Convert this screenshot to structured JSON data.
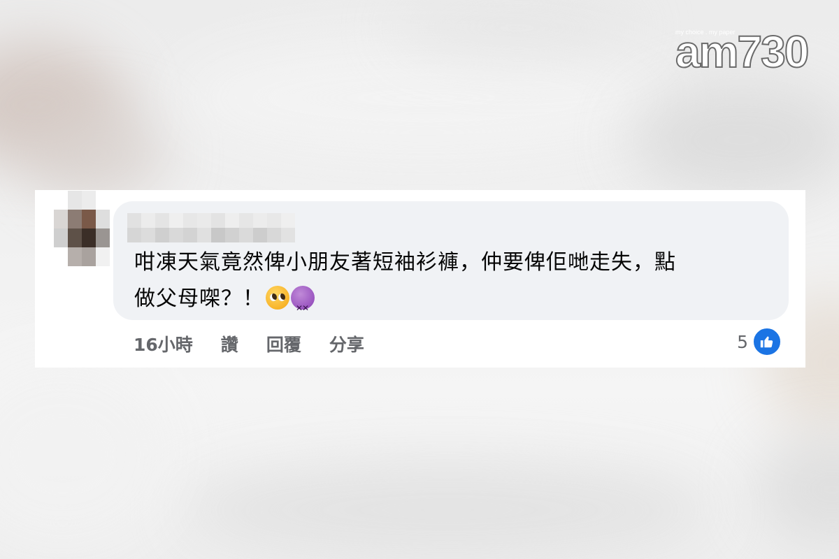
{
  "logo": {
    "tagline": "my choice . my paper",
    "text": "am730"
  },
  "comment": {
    "author_name": "",
    "text_line1": "咁凍天氣竟然俾小朋友著短袖衫褲，仲要俾佢哋走失，點",
    "text_line2": "做父母㗎？！",
    "emojis": [
      "pleading-face",
      "dizzy-face"
    ]
  },
  "actions": {
    "timestamp": "16小時",
    "like_label": "讚",
    "reply_label": "回覆",
    "share_label": "分享"
  },
  "reactions": {
    "count": "5",
    "icon": "thumbs-up-icon",
    "color": "#1b74e4"
  }
}
